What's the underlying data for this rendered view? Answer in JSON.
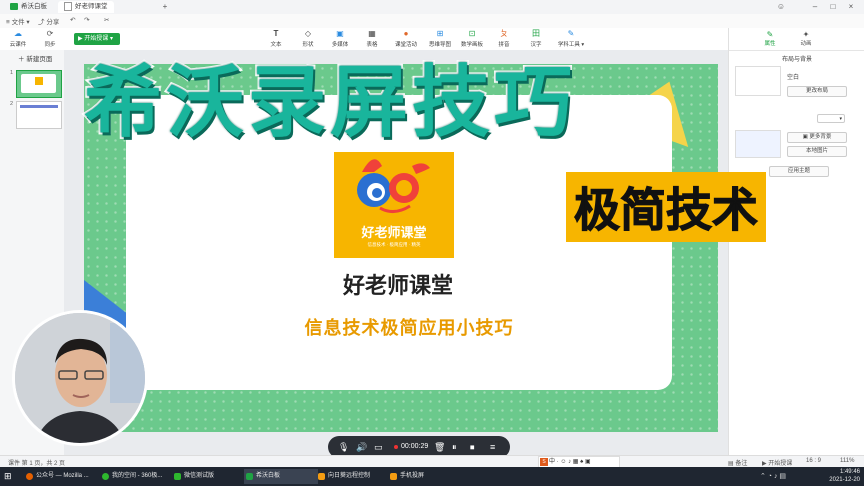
{
  "window": {
    "tabs": [
      {
        "label": "希沃白板"
      },
      {
        "label": "好老师课堂"
      }
    ]
  },
  "menu": {
    "file": "文件",
    "share": "分享"
  },
  "toolbar": {
    "cloud": "云课件",
    "sync": "同步",
    "start_label": "开始授课",
    "items": [
      "文本",
      "形状",
      "多媒体",
      "表格",
      "课堂活动",
      "思维导图",
      "数学画板",
      "拼音",
      "汉字",
      "学科工具"
    ]
  },
  "left_panel": {
    "new_page": "新建页面",
    "pages": [
      "1",
      "2"
    ]
  },
  "slide": {
    "logo_text": "好老师课堂",
    "logo_tagline": "信息技术 · 极简应用 · 精英",
    "main_title": "好老师课堂",
    "subtitle": "信息技术极简应用小技巧"
  },
  "overlay": {
    "title": "希沃录屏技巧",
    "subtitle": "极简技术"
  },
  "right_panel": {
    "tab_props": "属性",
    "tab_anim": "动画",
    "layout_header": "布局与背景",
    "blank": "空白",
    "change_layout": "更改布局",
    "more_bg": "更多背景",
    "local_image": "本地图片",
    "apply_all": "应用主题"
  },
  "recording": {
    "time": "00:00:29"
  },
  "status_bar": {
    "page_info": "课件 第 1 页，共 2 页",
    "notes": "备注",
    "start_teach": "开始授课",
    "ratio": "16 : 9",
    "zoom": "111%"
  },
  "taskbar": {
    "items": [
      {
        "label": "公众号 — Mozilla ...",
        "color": "#e66000"
      },
      {
        "label": "我的空间 - 360极...",
        "color": "#2eb82e"
      },
      {
        "label": "微信测试版",
        "color": "#2eb82e"
      },
      {
        "label": "希沃白板",
        "color": "#1fa344"
      },
      {
        "label": "向日葵远程控制",
        "color": "#f39c12"
      },
      {
        "label": "手机投屏",
        "color": "#f39c12"
      }
    ],
    "time": "1:49:46",
    "date": "2021-12-20"
  }
}
